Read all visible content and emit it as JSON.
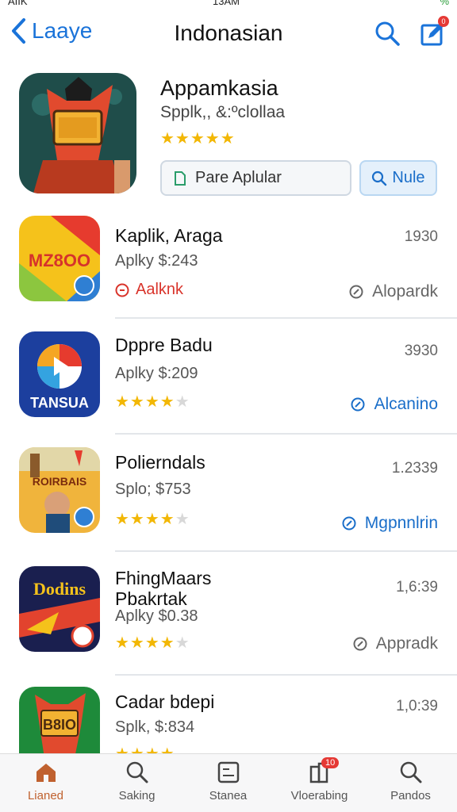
{
  "status_bar": {
    "carrier": "AIIK",
    "time": "13AM",
    "battery": "%"
  },
  "nav": {
    "back_label": "Laaye",
    "title": "Indonasian",
    "compose_badge": "0"
  },
  "featured": {
    "name": "Appamkasia",
    "subtitle": "Spplk,, &:ºclollaa",
    "stars": "★★★★★",
    "button_primary": "Pare Aplular",
    "button_secondary": "Nule"
  },
  "apps": [
    {
      "name": "Kaplik, Araga",
      "price": "Aplky $:243",
      "number": "1930",
      "rating_tag": "Aalknk",
      "action": "Alopardk",
      "action_style": "gray",
      "icon_text": "MZ8OO"
    },
    {
      "name": "Dppre Badu",
      "price": "Aplky $:209",
      "number": "3930",
      "stars": "★★★★",
      "stars_half": "★",
      "action": "Alcanino",
      "action_style": "blue",
      "icon_text": "TANSUA"
    },
    {
      "name": "Polierndals",
      "price": "Splo; $753",
      "number": "1.2339",
      "stars": "★★★★",
      "stars_half": "★",
      "action": "Mgpnnlrin",
      "action_style": "blue",
      "icon_text": "ROIRBAIS"
    },
    {
      "name": "FhingMaars Pbakrtak",
      "price": "Aplky $0.38",
      "number": "1,6:39",
      "stars": "★★★★",
      "stars_half": "★",
      "action": "Appradk",
      "action_style": "gray",
      "icon_text": "Dodins"
    },
    {
      "name": "Cadar bdepi",
      "price": "Splk, $:834",
      "number": "1,0:39",
      "stars": "★★★★",
      "stars_half": "",
      "action": "",
      "action_style": "gray",
      "icon_text": "B8IO"
    }
  ],
  "tabs": [
    {
      "label": "Lianed",
      "icon": "home-icon",
      "active": true
    },
    {
      "label": "Saking",
      "icon": "search-icon"
    },
    {
      "label": "Stanea",
      "icon": "list-icon"
    },
    {
      "label": "Vloerabing",
      "icon": "updates-icon",
      "badge": "10"
    },
    {
      "label": "Pandos",
      "icon": "search-icon"
    }
  ],
  "colors": {
    "accent": "#1a73d9",
    "star": "#f2b705",
    "tab_active": "#c0612f",
    "badge": "#e53935"
  }
}
